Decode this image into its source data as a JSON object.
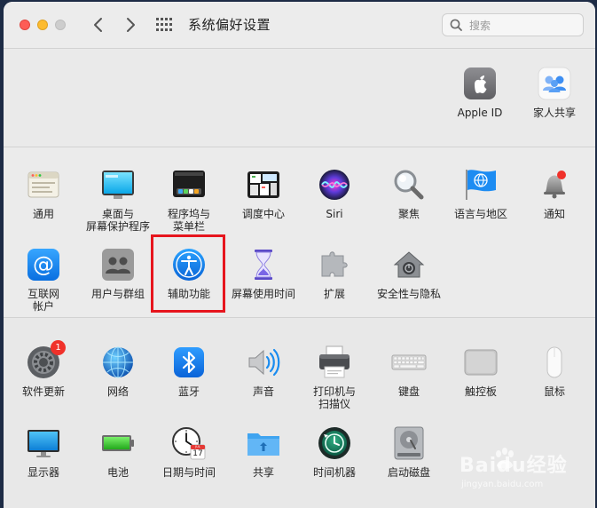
{
  "window": {
    "title": "系统偏好设置"
  },
  "search": {
    "placeholder": "搜索",
    "value": ""
  },
  "account": [
    {
      "id": "apple-id",
      "label": "Apple ID",
      "icon": "apple-logo-icon"
    },
    {
      "id": "family-sharing",
      "label": "家人共享",
      "icon": "family-icon"
    }
  ],
  "personal": [
    {
      "id": "general",
      "label": "通用",
      "icon": "general-icon"
    },
    {
      "id": "desktop",
      "label": "桌面与\n屏幕保护程序",
      "icon": "desktop-icon"
    },
    {
      "id": "dock",
      "label": "程序坞与\n菜单栏",
      "icon": "dock-icon"
    },
    {
      "id": "mission-control",
      "label": "调度中心",
      "icon": "mission-control-icon"
    },
    {
      "id": "siri",
      "label": "Siri",
      "icon": "siri-icon"
    },
    {
      "id": "spotlight",
      "label": "聚焦",
      "icon": "magnifier-icon"
    },
    {
      "id": "language",
      "label": "语言与地区",
      "icon": "globe-flag-icon"
    },
    {
      "id": "notifications",
      "label": "通知",
      "icon": "bell-icon"
    },
    {
      "id": "internet-accounts",
      "label": "互联网\n帐户",
      "icon": "at-sign-icon"
    },
    {
      "id": "users-groups",
      "label": "用户与群组",
      "icon": "users-icon"
    },
    {
      "id": "accessibility",
      "label": "辅助功能",
      "icon": "accessibility-icon"
    },
    {
      "id": "screen-time",
      "label": "屏幕使用时间",
      "icon": "hourglass-icon"
    },
    {
      "id": "extensions",
      "label": "扩展",
      "icon": "puzzle-icon"
    },
    {
      "id": "security",
      "label": "安全性与隐私",
      "icon": "house-lock-icon"
    }
  ],
  "hardware": [
    {
      "id": "software-update",
      "label": "软件更新",
      "icon": "gear-icon",
      "badge": "1"
    },
    {
      "id": "network",
      "label": "网络",
      "icon": "network-globe-icon"
    },
    {
      "id": "bluetooth",
      "label": "蓝牙",
      "icon": "bluetooth-icon"
    },
    {
      "id": "sound",
      "label": "声音",
      "icon": "speaker-icon"
    },
    {
      "id": "printers",
      "label": "打印机与\n扫描仪",
      "icon": "printer-icon"
    },
    {
      "id": "keyboard",
      "label": "键盘",
      "icon": "keyboard-icon"
    },
    {
      "id": "trackpad",
      "label": "触控板",
      "icon": "trackpad-icon"
    },
    {
      "id": "mouse",
      "label": "鼠标",
      "icon": "mouse-icon"
    },
    {
      "id": "displays",
      "label": "显示器",
      "icon": "display-icon"
    },
    {
      "id": "battery",
      "label": "电池",
      "icon": "battery-icon"
    },
    {
      "id": "date-time",
      "label": "日期与时间",
      "icon": "clock-calendar-icon",
      "calendar_month": "JUL",
      "calendar_day": "17"
    },
    {
      "id": "sharing",
      "label": "共享",
      "icon": "folder-share-icon"
    },
    {
      "id": "time-machine",
      "label": "时间机器",
      "icon": "time-machine-icon"
    },
    {
      "id": "startup-disk",
      "label": "启动磁盘",
      "icon": "hard-disk-icon"
    }
  ],
  "watermark": {
    "text": "Baidu经验",
    "subtext": "jingyan.baidu.com"
  },
  "colors": {
    "highlight": "#e6151d",
    "badge": "#f0312a",
    "accent": "#1a7cf0"
  }
}
